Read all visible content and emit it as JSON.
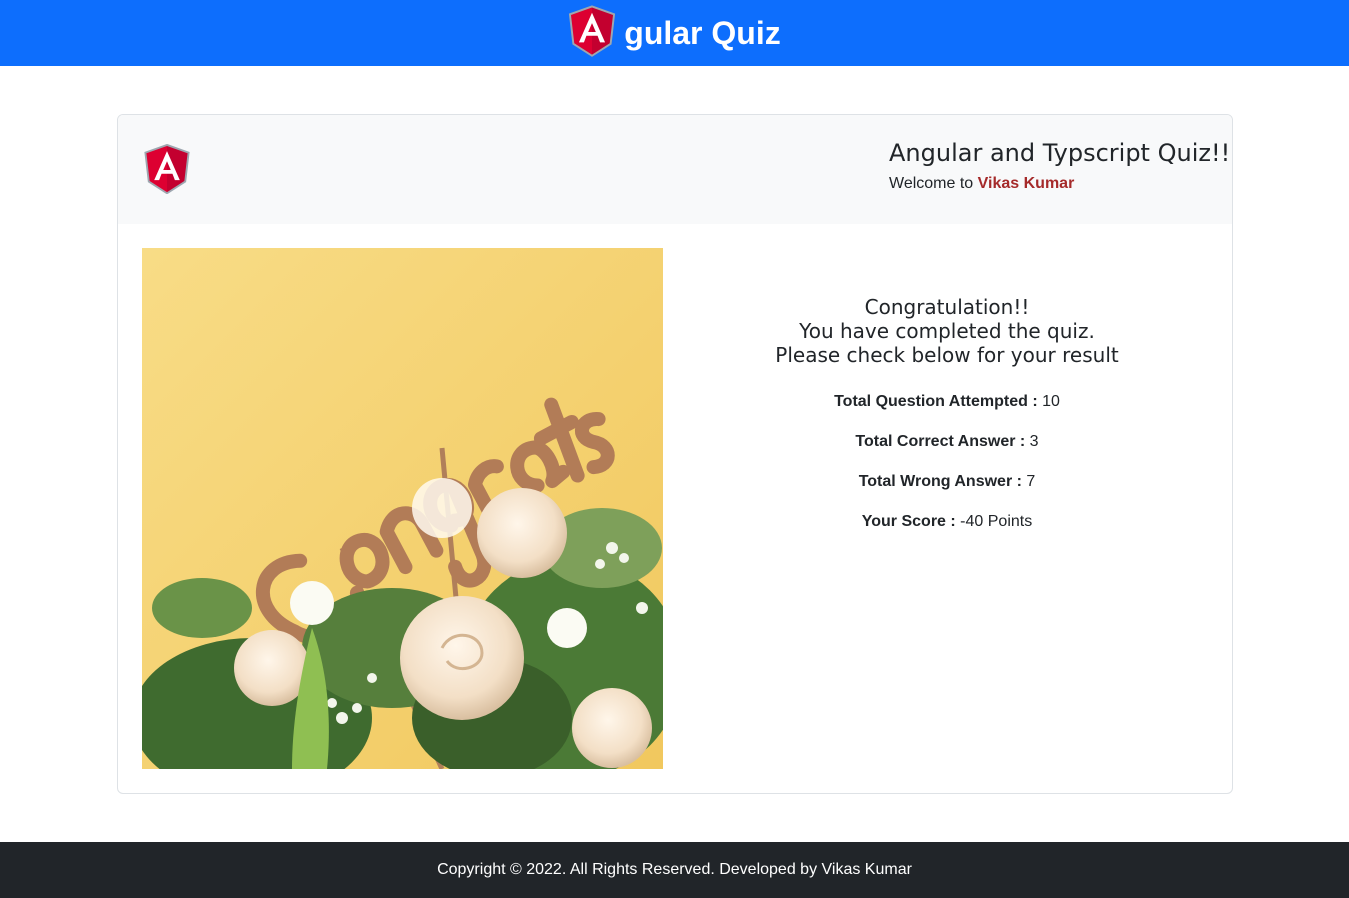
{
  "navbar": {
    "logo_icon": "angular-logo-icon",
    "brand_text": "gular Quiz",
    "color": "#0d6efd"
  },
  "card": {
    "header": {
      "logo_icon": "angular-logo-icon",
      "title": "Angular and Typscript Quiz!!",
      "welcome_prefix": "Welcome to",
      "user_name": "Vikas Kumar",
      "user_color": "#a52a2a"
    },
    "image_icon": "congrats-flowers-image",
    "result": {
      "line1": "Congratulation!!",
      "line2": "You have completed the quiz.",
      "line3": "Please check below for your result",
      "stats": [
        {
          "label": "Total Question Attempted :",
          "value": "10"
        },
        {
          "label": "Total Correct Answer :",
          "value": "3"
        },
        {
          "label": "Total Wrong Answer :",
          "value": "7"
        },
        {
          "label": "Your Score :",
          "value": "-40 Points"
        }
      ]
    }
  },
  "footer": {
    "text": "Copyright © 2022. All Rights Reserved. Developed by Vikas Kumar",
    "color": "#212529"
  }
}
